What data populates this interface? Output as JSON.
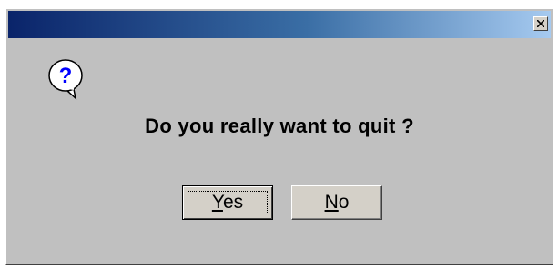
{
  "dialog": {
    "title": "",
    "message": "Do you really want to quit ?",
    "icon": "question-icon",
    "close_icon": "close-icon"
  },
  "buttons": {
    "yes": {
      "mnemonic": "Y",
      "rest": "es"
    },
    "no": {
      "mnemonic": "N",
      "rest": "o"
    }
  },
  "colors": {
    "dialog_bg": "#c0c0c0",
    "titlebar_start": "#0a246a",
    "titlebar_end": "#a6caf0",
    "button_bg": "#d4d0c8",
    "icon_mark": "#0000ff"
  }
}
